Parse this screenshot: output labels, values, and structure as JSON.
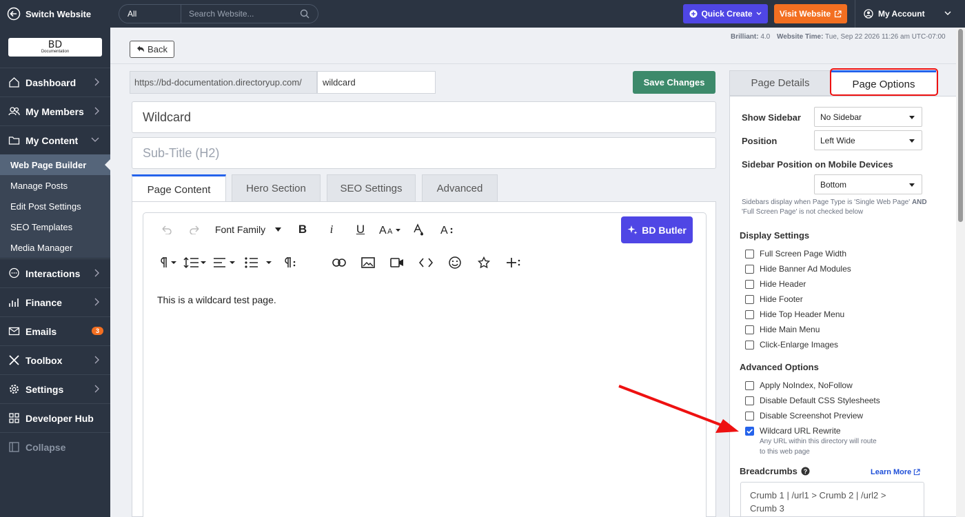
{
  "topbar": {
    "switch_label": "Switch Website",
    "search_scope": "All",
    "search_placeholder": "Search Website...",
    "quick_create": "Quick Create",
    "visit_website": "Visit Website",
    "account": "My Account"
  },
  "sidebar": {
    "logo_main": "BD",
    "logo_sub": "Documentation",
    "items": [
      {
        "label": "Dashboard",
        "icon": "home-icon"
      },
      {
        "label": "My Members",
        "icon": "users-icon"
      },
      {
        "label": "My Content",
        "icon": "folder-icon"
      },
      {
        "label": "Interactions",
        "icon": "chat-icon"
      },
      {
        "label": "Finance",
        "icon": "chart-icon"
      },
      {
        "label": "Emails",
        "icon": "mail-icon",
        "badge": "3"
      },
      {
        "label": "Toolbox",
        "icon": "tools-icon"
      },
      {
        "label": "Settings",
        "icon": "gear-icon"
      },
      {
        "label": "Developer Hub",
        "icon": "grid-icon"
      },
      {
        "label": "Collapse",
        "icon": "collapse-icon"
      }
    ],
    "content_sub": [
      "Web Page Builder",
      "Manage Posts",
      "Edit Post Settings",
      "SEO Templates",
      "Media Manager"
    ]
  },
  "info": {
    "brilliant_label": "Brilliant:",
    "brilliant_value": "4.0",
    "time_label": "Website Time:",
    "time_value": "Tue, Sep 22 2026 11:26 am UTC-07:00"
  },
  "page": {
    "back_label": "Back",
    "url_prefix": "https://bd-documentation.directoryup.com/",
    "url_slug": "wildcard",
    "save_label": "Save Changes",
    "title_value": "Wildcard",
    "subtitle_placeholder": "Sub-Title (H2)",
    "tabs": [
      "Page Content",
      "Hero Section",
      "SEO Settings",
      "Advanced"
    ]
  },
  "editor": {
    "font_family": "Font Family",
    "butler_label": "BD Butler",
    "body_text": "This is a wildcard test page."
  },
  "options": {
    "tabs": [
      "Page Details",
      "Page Options"
    ],
    "show_sidebar_label": "Show Sidebar",
    "show_sidebar_value": "No Sidebar",
    "position_label": "Position",
    "position_value": "Left Wide",
    "mobile_label": "Sidebar Position on Mobile Devices",
    "mobile_value": "Bottom",
    "note_a": "Sidebars display when Page Type is 'Single Web Page'",
    "note_and": "AND",
    "note_b": "'Full Screen Page' is not checked below",
    "display_heading": "Display Settings",
    "display_items": [
      {
        "label": "Full Screen Page Width",
        "checked": false
      },
      {
        "label": "Hide Banner Ad Modules",
        "checked": false
      },
      {
        "label": "Hide Header",
        "checked": false
      },
      {
        "label": "Hide Footer",
        "checked": false
      },
      {
        "label": "Hide Top Header Menu",
        "checked": false
      },
      {
        "label": "Hide Main Menu",
        "checked": false
      },
      {
        "label": "Click-Enlarge Images",
        "checked": false
      }
    ],
    "advanced_heading": "Advanced Options",
    "advanced_items": [
      {
        "label": "Apply NoIndex, NoFollow",
        "checked": false
      },
      {
        "label": "Disable Default CSS Stylesheets",
        "checked": false
      },
      {
        "label": "Disable Screenshot Preview",
        "checked": false
      },
      {
        "label": "Wildcard URL Rewrite",
        "checked": true
      }
    ],
    "wildcard_note": "Any URL within this directory will route to this web page",
    "breadcrumbs_label": "Breadcrumbs",
    "learn_more": "Learn More",
    "breadcrumbs_value": "Crumb 1 | /url1 > Crumb 2 | /url2 > Crumb 3"
  },
  "colors": {
    "accent": "#4f46e5",
    "orange": "#f36f21",
    "save_green": "#3d8a6b",
    "highlight_red": "#e11111"
  }
}
